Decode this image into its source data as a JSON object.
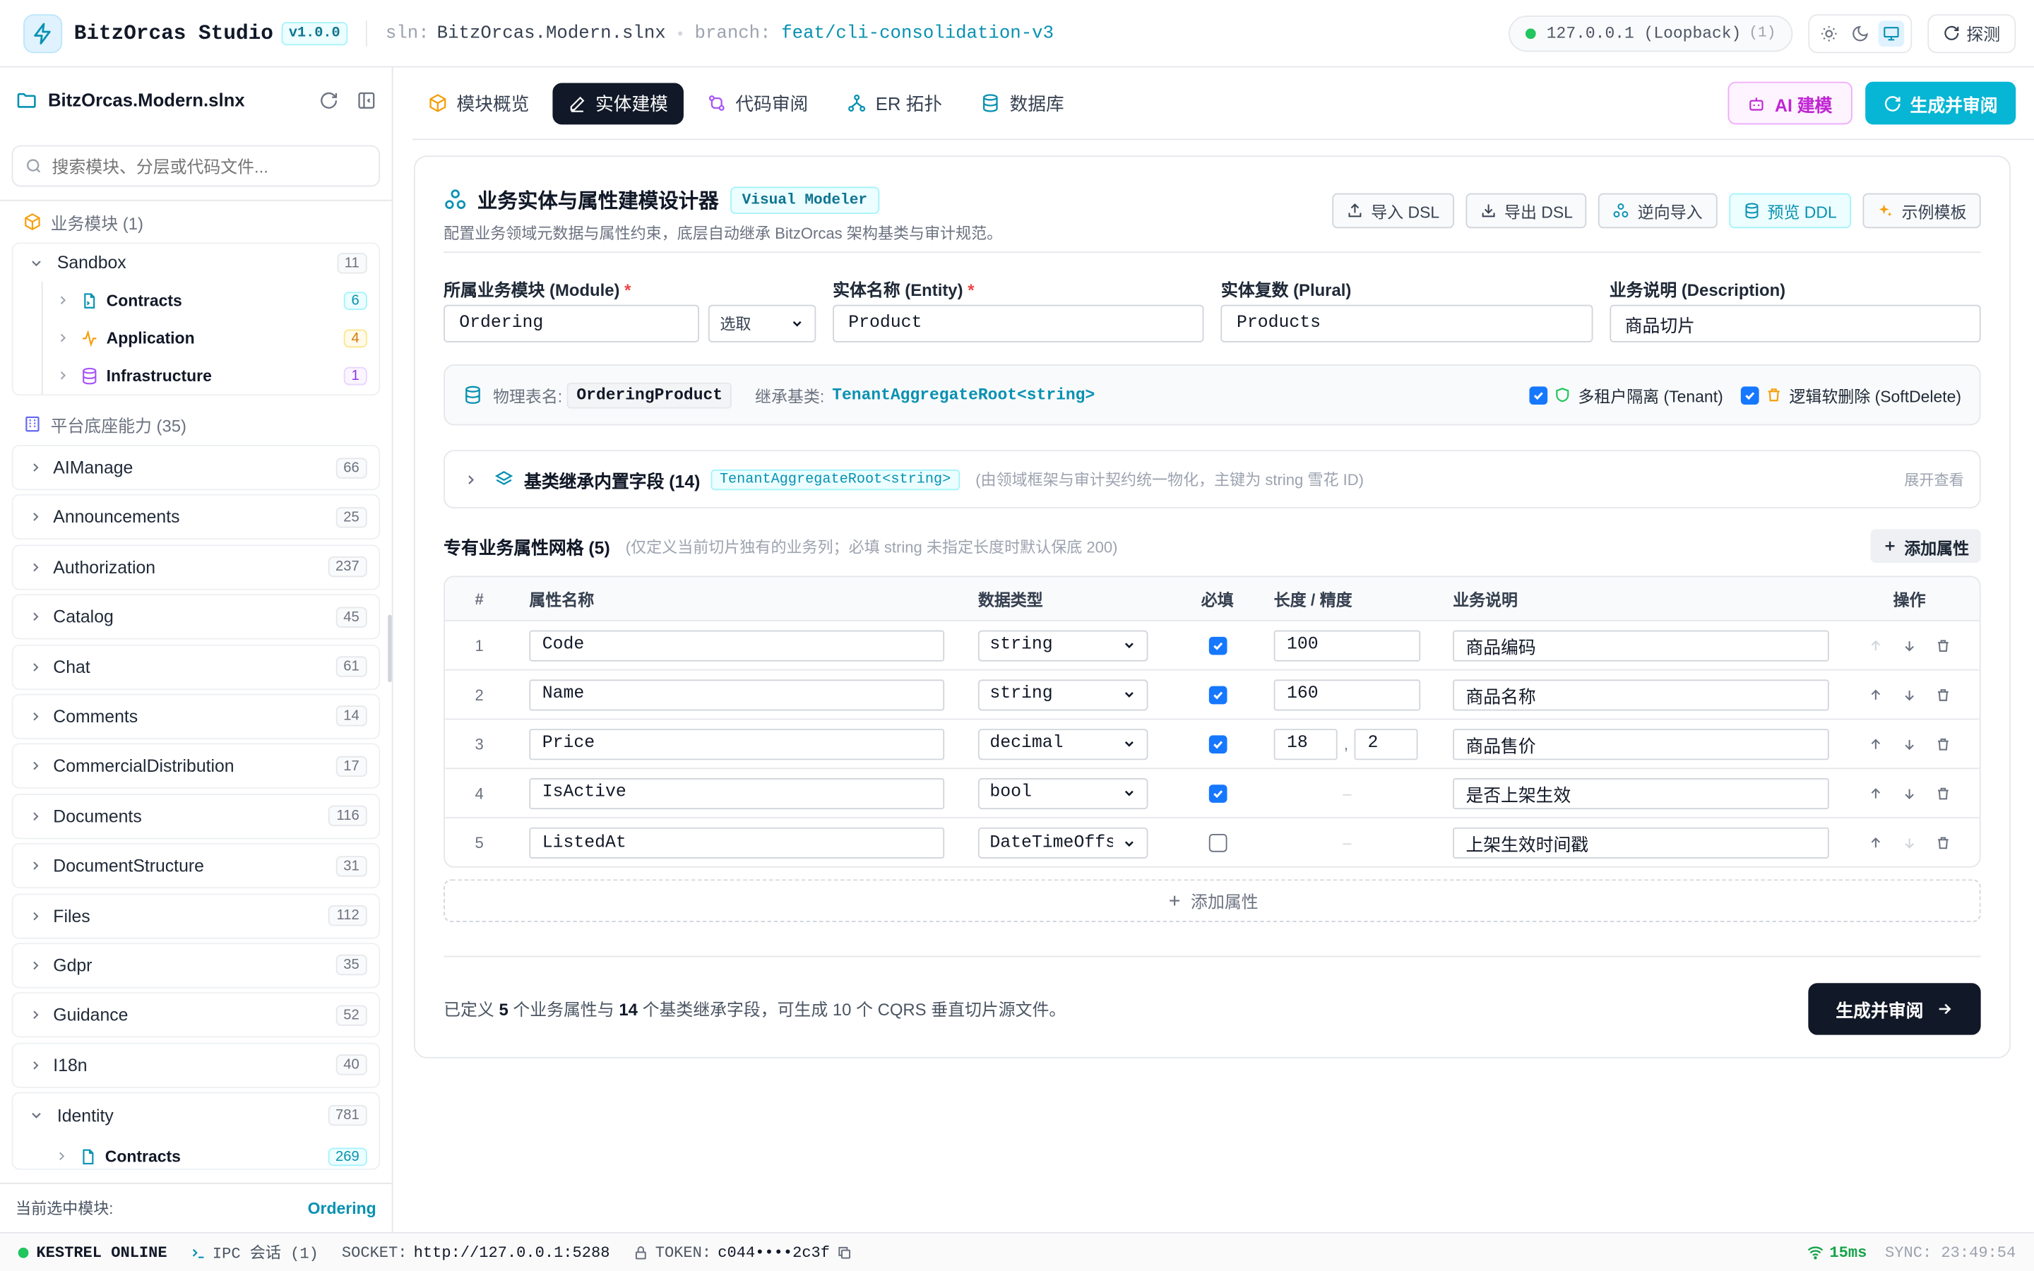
{
  "app": {
    "title": "BitzOrcas Studio",
    "version": "v1.0.0"
  },
  "header": {
    "sln_key": "sln:",
    "sln_value": "BitzOrcas.Modern.slnx",
    "branch_key": "branch:",
    "branch_value": "feat/cli-consolidation-v3",
    "host": "127.0.0.1 (Loopback)",
    "host_count": "(1)",
    "probe_label": "探测"
  },
  "sidebar": {
    "title": "BitzOrcas.Modern.slnx",
    "search_placeholder": "搜索模块、分层或代码文件...",
    "business_section": "业务模块 (1)",
    "sandbox": {
      "label": "Sandbox",
      "count": "11",
      "children": [
        {
          "label": "Contracts",
          "count": "6"
        },
        {
          "label": "Application",
          "count": "4"
        },
        {
          "label": "Infrastructure",
          "count": "1"
        }
      ]
    },
    "platform_section": "平台底座能力 (35)",
    "modules": [
      {
        "label": "AIManage",
        "count": "66"
      },
      {
        "label": "Announcements",
        "count": "25"
      },
      {
        "label": "Authorization",
        "count": "237"
      },
      {
        "label": "Catalog",
        "count": "45"
      },
      {
        "label": "Chat",
        "count": "61"
      },
      {
        "label": "Comments",
        "count": "14"
      },
      {
        "label": "CommercialDistribution",
        "count": "17"
      },
      {
        "label": "Documents",
        "count": "116"
      },
      {
        "label": "DocumentStructure",
        "count": "31"
      },
      {
        "label": "Files",
        "count": "112"
      },
      {
        "label": "Gdpr",
        "count": "35"
      },
      {
        "label": "Guidance",
        "count": "52"
      },
      {
        "label": "I18n",
        "count": "40"
      }
    ],
    "identity": {
      "label": "Identity",
      "count": "781",
      "child_label": "Contracts",
      "child_count": "269"
    },
    "footer_label": "当前选中模块:",
    "footer_value": "Ordering"
  },
  "tabs": [
    {
      "label": "模块概览"
    },
    {
      "label": "实体建模"
    },
    {
      "label": "代码审阅"
    },
    {
      "label": "ER 拓扑"
    },
    {
      "label": "数据库"
    }
  ],
  "toolbar": {
    "ai_label": "AI 建模",
    "generate_label": "生成并审阅"
  },
  "designer": {
    "title": "业务实体与属性建模设计器",
    "badge": "Visual Modeler",
    "subtitle": "配置业务领域元数据与属性约束，底层自动继承 BitzOrcas 架构基类与审计规范。",
    "actions": {
      "import": "导入 DSL",
      "export": "导出 DSL",
      "reverse": "逆向导入",
      "preview": "预览 DDL",
      "sample": "示例模板"
    }
  },
  "form": {
    "module_label": "所属业务模块 (Module)",
    "module_value": "Ordering",
    "module_select": "选取",
    "entity_label": "实体名称 (Entity)",
    "entity_value": "Product",
    "plural_label": "实体复数 (Plural)",
    "plural_value": "Products",
    "desc_label": "业务说明 (Description)",
    "desc_value": "商品切片",
    "required_mark": "*"
  },
  "physical": {
    "table_key": "物理表名:",
    "table_value": "OrderingProduct",
    "base_key": "继承基类:",
    "base_value": "TenantAggregateRoot<string>",
    "tenant_label": "多租户隔离 (Tenant)",
    "tenant_checked": true,
    "softdelete_label": "逻辑软删除 (SoftDelete)",
    "softdelete_checked": true
  },
  "inherit": {
    "title": "基类继承内置字段 (14)",
    "badge": "TenantAggregateRoot<string>",
    "note": "(由领域框架与审计契约统一物化，主键为 string 雪花 ID)",
    "expand": "展开查看"
  },
  "grid": {
    "title": "专有业务属性网格 (5)",
    "note": "(仅定义当前切片独有的业务列；必填 string 未指定长度时默认保底 200)",
    "add_label": "添加属性",
    "headers": {
      "num": "#",
      "name": "属性名称",
      "type": "数据类型",
      "required": "必填",
      "length": "长度 / 精度",
      "desc": "业务说明",
      "ops": "操作"
    },
    "rows": [
      {
        "num": "1",
        "name": "Code",
        "type": "string",
        "required": true,
        "length": "100",
        "precision": "",
        "desc": "商品编码"
      },
      {
        "num": "2",
        "name": "Name",
        "type": "string",
        "required": true,
        "length": "160",
        "precision": "",
        "desc": "商品名称"
      },
      {
        "num": "3",
        "name": "Price",
        "type": "decimal",
        "required": true,
        "length": "18",
        "precision": "2",
        "desc": "商品售价"
      },
      {
        "num": "4",
        "name": "IsActive",
        "type": "bool",
        "required": true,
        "length": "-",
        "precision": "",
        "desc": "是否上架生效"
      },
      {
        "num": "5",
        "name": "ListedAt",
        "type": "DateTimeOffset",
        "required": false,
        "length": "-",
        "precision": "",
        "desc": "上架生效时间戳"
      }
    ],
    "add_bottom_label": "添加属性"
  },
  "footer": {
    "text_prefix": "已定义",
    "attr_count": "5",
    "text_mid": "个业务属性与",
    "base_count": "14",
    "text_suffix": "个基类继承字段，可生成 10 个 CQRS 垂直切片源文件。",
    "button": "生成并审阅"
  },
  "statusbar": {
    "online": "KESTREL ONLINE",
    "ipc": "IPC 会话 (1)",
    "socket_key": "SOCKET:",
    "socket_value": "http://127.0.0.1:5288",
    "token_key": "TOKEN:",
    "token_value": "c044••••2c3f",
    "latency": "15ms",
    "sync_key": "SYNC:",
    "sync_value": "23:49:54"
  },
  "colors": {
    "accent": "#06b6d4",
    "primary_dark": "#111827",
    "ai": "#c026d3",
    "online": "#22c55e"
  }
}
